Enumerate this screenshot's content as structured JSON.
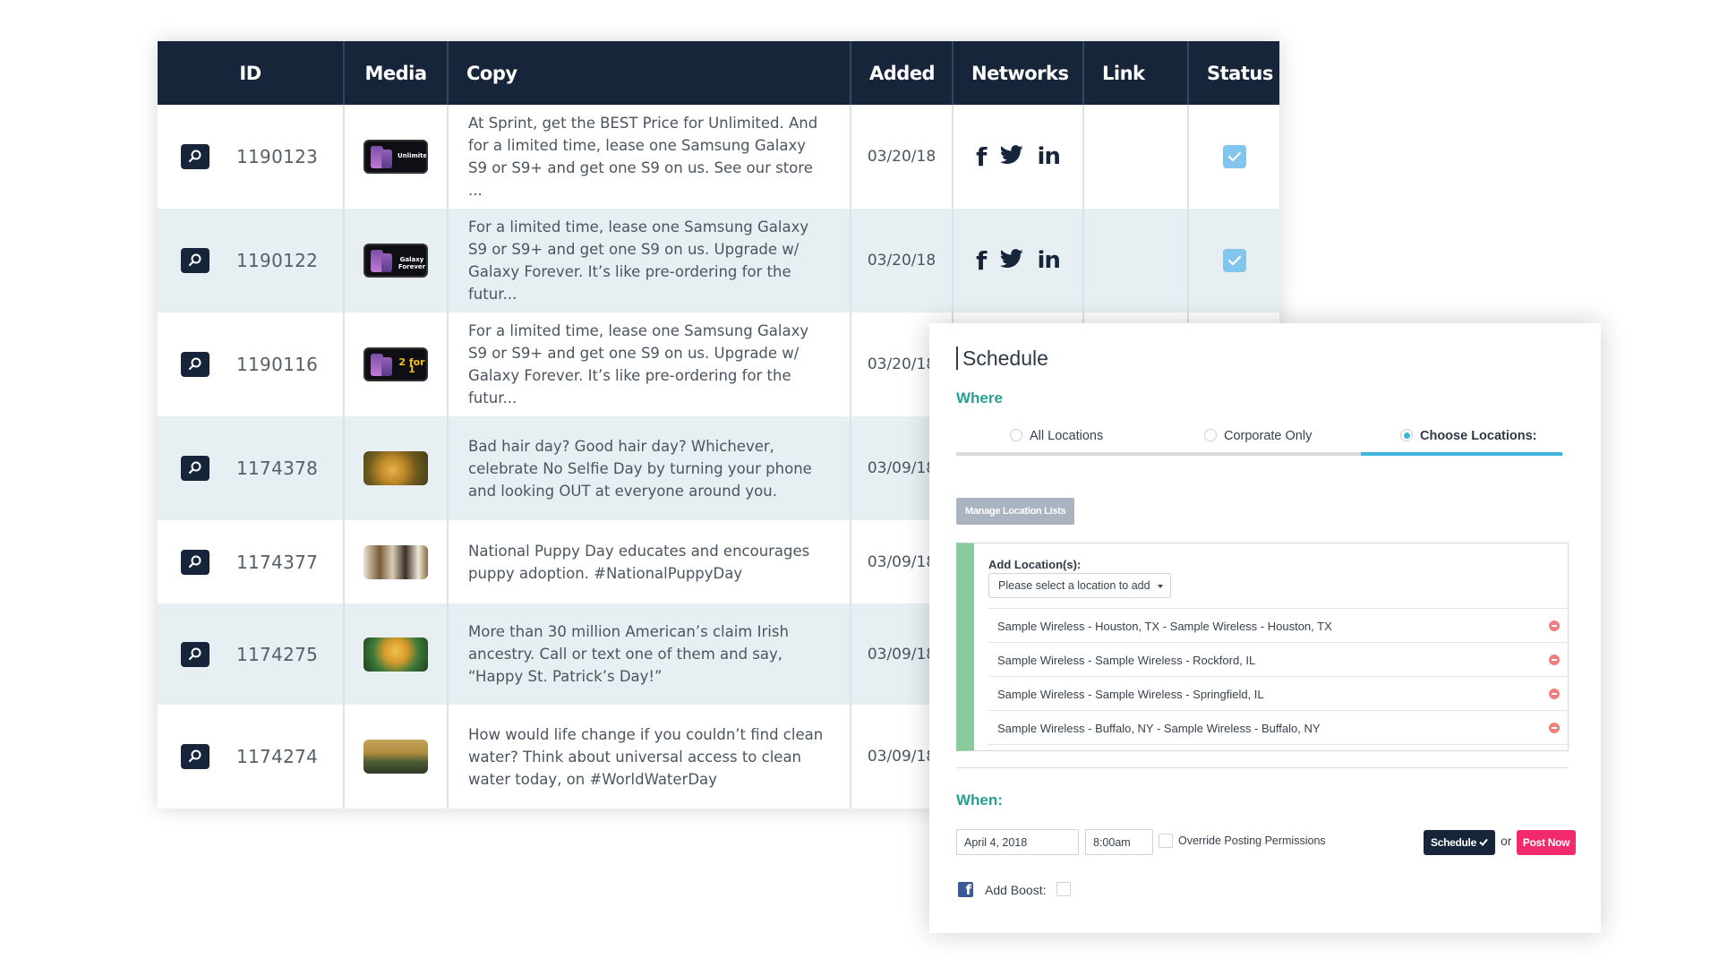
{
  "table": {
    "headers": {
      "id": "ID",
      "media": "Media",
      "copy": "Copy",
      "added": "Added",
      "networks": "Networks",
      "link": "Link",
      "status": "Status"
    },
    "rows": [
      {
        "id": "1190123",
        "thumb_label": "Unlimited",
        "copy": "At Sprint, get the BEST Price for Unlimited. And for a limited time, lease one Samsung Galaxy S9 or S9+ and get one S9 on us. See our store ...",
        "added": "03/20/18",
        "networks": [
          "facebook-icon",
          "twitter-icon",
          "linkedin-icon"
        ],
        "status_checked": true
      },
      {
        "id": "1190122",
        "thumb_label": "Galaxy Forever",
        "copy": "For a limited time, lease one Samsung Galaxy S9 or S9+ and get one S9 on us. Upgrade w/ Galaxy Forever. It’s like pre-ordering for the futur...",
        "added": "03/20/18",
        "networks": [
          "facebook-icon",
          "twitter-icon",
          "linkedin-icon"
        ],
        "status_checked": true
      },
      {
        "id": "1190116",
        "thumb_label": "2 for 1",
        "copy": "For a limited time, lease one Samsung Galaxy S9 or S9+ and get one S9 on us. Upgrade w/ Galaxy Forever. It’s like pre-ordering for the futur...",
        "added": "03/20/18"
      },
      {
        "id": "1174378",
        "copy": "Bad hair day? Good hair day? Whichever, celebrate No Selfie Day by turning your phone and looking OUT at everyone around you.",
        "added": "03/09/18"
      },
      {
        "id": "1174377",
        "copy": "National Puppy Day educates and encourages puppy adoption. #NationalPuppyDay",
        "added": "03/09/18"
      },
      {
        "id": "1174275",
        "copy": "More than 30 million American’s claim Irish ancestry. Call or text one of them and say, “Happy St. Patrick’s Day!”",
        "added": "03/09/18"
      },
      {
        "id": "1174274",
        "copy": "How would life change if you couldn’t find clean water? Think about universal access to clean water today, on #WorldWaterDay",
        "added": "03/09/18"
      }
    ]
  },
  "schedule": {
    "title": "Schedule",
    "where_label": "Where",
    "radio_options": [
      "All Locations",
      "Corporate Only",
      "Choose Locations:"
    ],
    "selected_option": "Choose Locations:",
    "manage_button": "Manage Location Lists",
    "add_locations_label": "Add Location(s):",
    "select_placeholder": "Please select a location to add",
    "locations": [
      "Sample Wireless - Houston, TX - Sample Wireless - Houston, TX",
      "Sample Wireless - Sample Wireless - Rockford, IL",
      "Sample Wireless - Sample Wireless - Springfield, IL",
      "Sample Wireless - Buffalo, NY - Sample Wireless - Buffalo, NY"
    ],
    "when_label": "When:",
    "date_value": "April 4, 2018",
    "time_value": "8:00am",
    "override_label": "Override Posting Permissions",
    "schedule_button": "Schedule",
    "or_text": "or",
    "post_now_button": "Post Now",
    "add_boost_label": "Add Boost:"
  },
  "colors": {
    "header_bg": "#17253a",
    "teal_label": "#22a294",
    "accent_blue": "#3fb4dd",
    "post_now_pink": "#f22a6c",
    "location_bar_green": "#8acb9e",
    "status_check_blue": "#82c6ee"
  }
}
